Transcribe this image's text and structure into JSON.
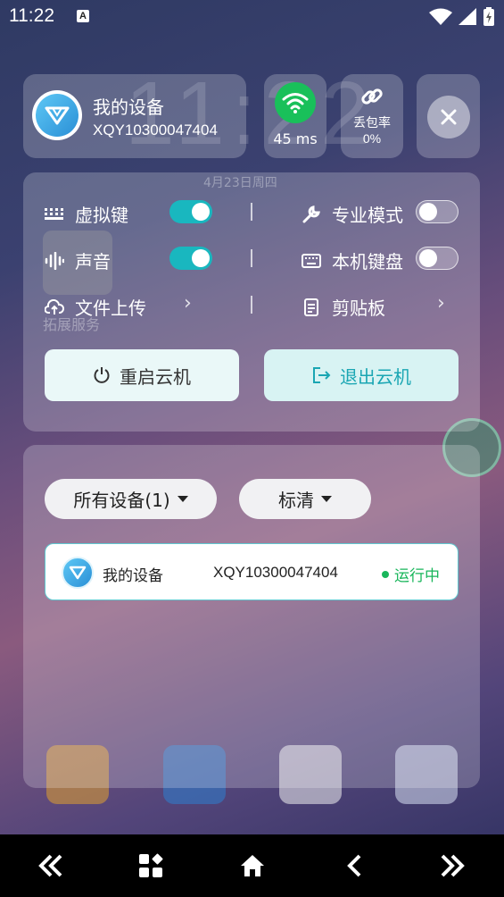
{
  "status_bar": {
    "time": "11:22",
    "notification_icon": "A"
  },
  "wallpaper": {
    "clock": "11:22",
    "date": "4月23日周四",
    "app_label": "拓展服务"
  },
  "device_card": {
    "name": "我的设备",
    "id": "XQY10300047404"
  },
  "network": {
    "latency": "45 ms",
    "loss_label": "丢包率",
    "loss_value": "0%"
  },
  "controls": {
    "virtual_keys": {
      "label": "虚拟键",
      "enabled": true
    },
    "pro_mode": {
      "label": "专业模式",
      "enabled": false
    },
    "sound": {
      "label": "声音",
      "enabled": true
    },
    "local_keyboard": {
      "label": "本机键盘",
      "enabled": false
    },
    "file_upload": {
      "label": "文件上传"
    },
    "clipboard": {
      "label": "剪贴板"
    },
    "restart_label": "重启云机",
    "exit_label": "退出云机"
  },
  "device_list": {
    "filter_label": "所有设备(1)",
    "quality_label": "标清",
    "items": [
      {
        "name": "我的设备",
        "id": "XQY10300047404",
        "status": "运行中"
      }
    ]
  },
  "colors": {
    "accent": "#19b7bf",
    "running": "#19b65b",
    "wifi": "#19c05a"
  }
}
